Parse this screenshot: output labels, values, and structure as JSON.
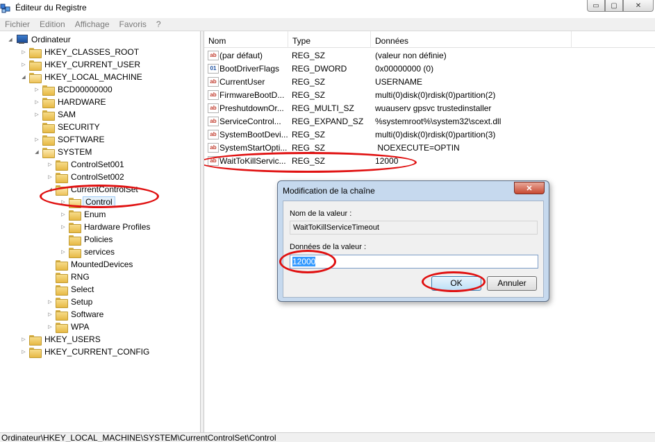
{
  "window": {
    "title": "Éditeur du Registre",
    "minimize_glyph": "▭",
    "maximize_glyph": "▢",
    "close_glyph": "✕"
  },
  "menu": [
    "Fichier",
    "Edition",
    "Affichage",
    "Favoris",
    "?"
  ],
  "tree": {
    "root": "Ordinateur",
    "hives": {
      "classes_root": "HKEY_CLASSES_ROOT",
      "current_user": "HKEY_CURRENT_USER",
      "local_machine": "HKEY_LOCAL_MACHINE",
      "users": "HKEY_USERS",
      "current_config": "HKEY_CURRENT_CONFIG"
    },
    "hklm_children": [
      "BCD00000000",
      "HARDWARE",
      "SAM",
      "SECURITY",
      "SOFTWARE",
      "SYSTEM"
    ],
    "system_children": [
      "ControlSet001",
      "ControlSet002",
      "CurrentControlSet"
    ],
    "ccs_children": [
      "Control",
      "Enum",
      "Hardware Profiles",
      "Policies",
      "services"
    ],
    "system_children_after": [
      "MountedDevices",
      "RNG",
      "Select",
      "Setup",
      "Software",
      "WPA"
    ],
    "selected": "Control"
  },
  "list": {
    "columns": [
      "Nom",
      "Type",
      "Données"
    ],
    "rows": [
      {
        "name": "(par défaut)",
        "type": "REG_SZ",
        "data": "(valeur non définie)",
        "icon": "string-value-icon"
      },
      {
        "name": "BootDriverFlags",
        "type": "REG_DWORD",
        "data": "0x00000000 (0)",
        "icon": "dword-value-icon"
      },
      {
        "name": "CurrentUser",
        "type": "REG_SZ",
        "data": "USERNAME",
        "icon": "string-value-icon"
      },
      {
        "name": "FirmwareBootD...",
        "type": "REG_SZ",
        "data": "multi(0)disk(0)rdisk(0)partition(2)",
        "icon": "string-value-icon"
      },
      {
        "name": "PreshutdownOr...",
        "type": "REG_MULTI_SZ",
        "data": "wuauserv gpsvc trustedinstaller",
        "icon": "string-value-icon"
      },
      {
        "name": "ServiceControl...",
        "type": "REG_EXPAND_SZ",
        "data": "%systemroot%\\system32\\scext.dll",
        "icon": "string-value-icon"
      },
      {
        "name": "SystemBootDevi...",
        "type": "REG_SZ",
        "data": "multi(0)disk(0)rdisk(0)partition(3)",
        "icon": "string-value-icon"
      },
      {
        "name": "SystemStartOpti...",
        "type": "REG_SZ",
        "data": " NOEXECUTE=OPTIN",
        "icon": "string-value-icon"
      },
      {
        "name": "WaitToKillServic...",
        "type": "REG_SZ",
        "data": "12000",
        "icon": "string-value-icon"
      }
    ],
    "icon_glyphs": {
      "sz": "ab",
      "dword": "01"
    }
  },
  "dialog": {
    "title": "Modification de la chaîne",
    "close_glyph": "✕",
    "name_label": "Nom de la valeur :",
    "name_value": "WaitToKillServiceTimeout",
    "data_label": "Données de la valeur :",
    "data_value": "12000",
    "ok_label": "OK",
    "cancel_label": "Annuler"
  },
  "statusbar": "Ordinateur\\HKEY_LOCAL_MACHINE\\SYSTEM\\CurrentControlSet\\Control",
  "colors": {
    "annotation": "#e01010",
    "selection": "#3399ff",
    "dialog_frame": "#c6d9ee"
  }
}
